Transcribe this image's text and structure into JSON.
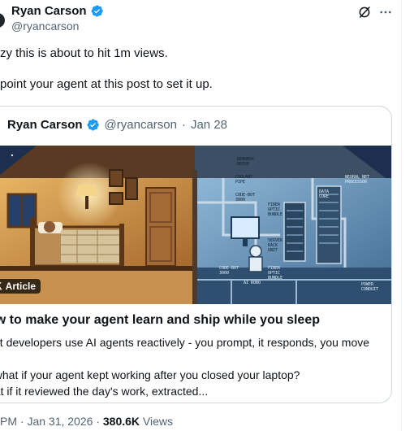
{
  "author": {
    "name": "Ryan Carson",
    "handle": "@ryancarson"
  },
  "tweet": {
    "lines": [
      "zy this is about to hit 1m views.",
      "point your agent at this post to set it up."
    ]
  },
  "quote": {
    "name": "Ryan Carson",
    "handle": "@ryancarson",
    "separator": "·",
    "date": "Jan 28",
    "badge": "Article",
    "title": "ow to make your agent learn and ship while you sleep",
    "snippet": [
      "ost developers use AI agents reactively - you prompt, it responds, you move",
      ".",
      "t what if your agent kept working after you closed your laptop?",
      "hat if it reviewed the day's work, extracted..."
    ],
    "image_labels": {
      "gearbox": "GEARBOX\nDRIVE",
      "coolant": "COOLANT\nPIPE",
      "codebot": "CODE-BOT\n3000",
      "fiber": "FIBER\nOPTIC\nBUNDLE",
      "rack": "SERVER\nRACK\nUNIT",
      "netproc": "NEURAL NET\nPROCESSOR",
      "datacore": "DATA\nCORE",
      "power": "POWER\nCONDUIT",
      "airobo": "AI ROBO",
      "codebot2": "CODE-BOT\n3000",
      "fiber2": "FIBER\nOPTIC\nBUNDLE"
    }
  },
  "meta": {
    "time": "PM",
    "separator": "·",
    "date": "Jan 31, 2026",
    "views_count": "380.6K",
    "views_label": "Views"
  },
  "colors": {
    "verified": "#1d9bf0",
    "secondary_text": "#536471",
    "border": "#cfd9de"
  },
  "icons": {
    "verified": "verified-badge-icon",
    "grok": "grok-icon",
    "more": "more-icon",
    "x_logo": "x-logo-icon"
  }
}
